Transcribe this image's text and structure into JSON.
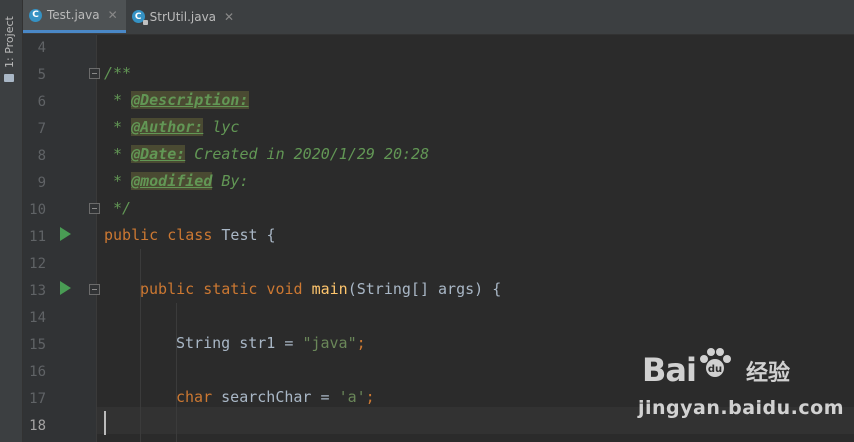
{
  "sidebar": {
    "project_label": "1: Project"
  },
  "tabs": [
    {
      "label": "Test.java",
      "active": true,
      "icon": "java-class-icon"
    },
    {
      "label": "StrUtil.java",
      "active": false,
      "icon": "java-class-locked-icon"
    }
  ],
  "editor": {
    "line_numbers": [
      "4",
      "5",
      "6",
      "7",
      "8",
      "9",
      "10",
      "11",
      "12",
      "13",
      "14",
      "15",
      "16",
      "17",
      "18"
    ],
    "current_line": "18",
    "code": {
      "l5": "/**",
      "l6_star": " * ",
      "l6_tag": "@Description:",
      "l7_star": " * ",
      "l7_tag": "@Author:",
      "l7_rest": " lyc",
      "l8_star": " * ",
      "l8_tag": "@Date:",
      "l8_rest": " Created in 2020/1/29 20:28",
      "l9_star": " * ",
      "l9_tag": "@modified",
      "l9_rest": " By:",
      "l10": " */",
      "l11_kw": "public class",
      "l11_rest": " Test {",
      "l13_kw": "public static void",
      "l13_fn": "main",
      "l13_rest": "(String[] args) {",
      "l15_a": "String str1 = ",
      "l15_str": "\"java\"",
      "l15_end": ";",
      "l17_kw": "char",
      "l17_a": " searchChar = ",
      "l17_str": "'a'",
      "l17_end": ";"
    }
  },
  "watermark": {
    "brand": "Bai",
    "brand_cn": "经验",
    "site": "jingyan.baidu.com"
  }
}
